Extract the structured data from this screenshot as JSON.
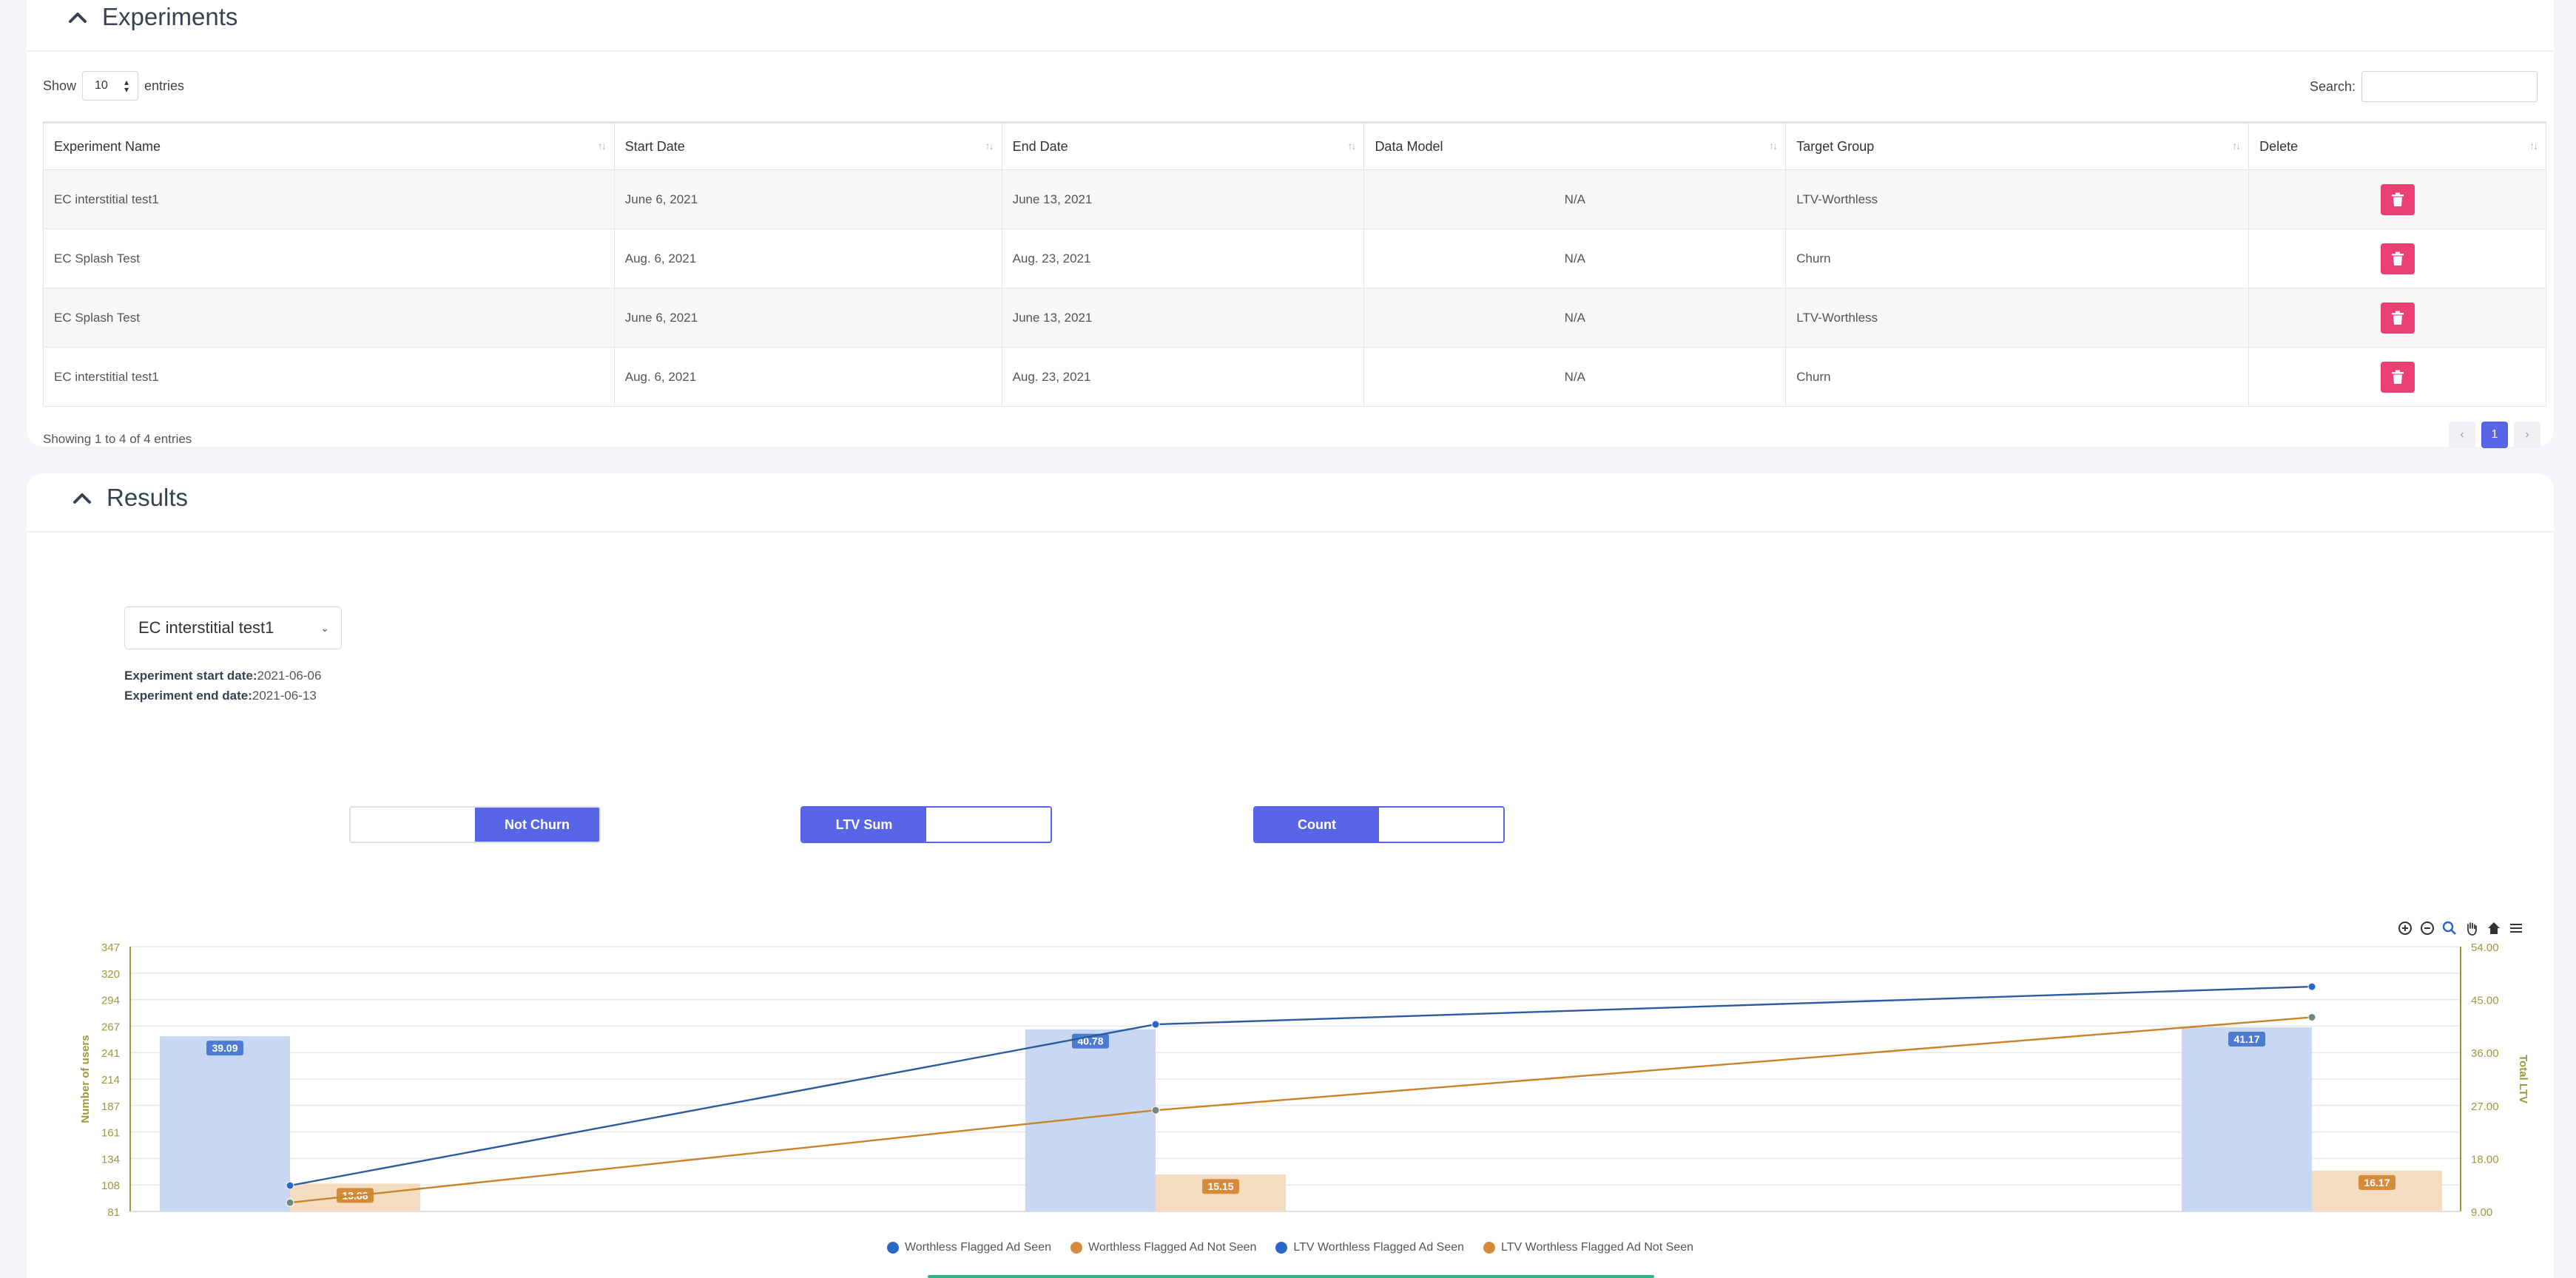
{
  "experiments": {
    "title": "Experiments",
    "show_label": "Show",
    "entries_label": "entries",
    "page_length": "10",
    "search_label": "Search:",
    "search_value": "",
    "columns": [
      "Experiment Name",
      "Start Date",
      "End Date",
      "Data Model",
      "Target Group",
      "Delete"
    ],
    "rows": [
      [
        "EC interstitial test1",
        "June 6, 2021",
        "June 13, 2021",
        "N/A",
        "LTV-Worthless"
      ],
      [
        "EC Splash Test",
        "Aug. 6, 2021",
        "Aug. 23, 2021",
        "N/A",
        "Churn"
      ],
      [
        "EC Splash Test",
        "June 6, 2021",
        "June 13, 2021",
        "N/A",
        "LTV-Worthless"
      ],
      [
        "EC interstitial test1",
        "Aug. 6, 2021",
        "Aug. 23, 2021",
        "N/A",
        "Churn"
      ]
    ],
    "info": "Showing 1 to 4 of 4 entries",
    "pager": {
      "prev": "‹",
      "current": "1",
      "next": "›"
    }
  },
  "results": {
    "title": "Results",
    "selected_experiment": "EC interstitial test1",
    "start_label": "Experiment start date:",
    "start_value": "2021-06-06",
    "end_label": "Experiment end date:",
    "end_value": "2021-06-13",
    "toggles": [
      {
        "left": "",
        "right": "Not Churn",
        "active": "right"
      },
      {
        "left": "LTV Sum",
        "right": "",
        "active": "left"
      },
      {
        "left": "Count",
        "right": "",
        "active": "left"
      }
    ]
  },
  "colors": {
    "accent": "#5865e6",
    "danger": "#ec3f74",
    "bar_blue": "#c9d8f2",
    "bar_orange": "#f4dcc1",
    "line_blue": "#2c5c9c",
    "line_orange": "#c8842a",
    "axis_olive": "#9a9a3c"
  },
  "chart_data": {
    "type": "bar",
    "ylabel": "Number of users",
    "y2label": "Total LTV",
    "y_ticks": [
      "81",
      "108",
      "134",
      "161",
      "187",
      "214",
      "241",
      "267",
      "294",
      "320",
      "347"
    ],
    "y2_ticks": [
      "9.00",
      "18.00",
      "27.00",
      "36.00",
      "45.00",
      "54.00"
    ],
    "ylim": [
      81,
      347
    ],
    "y2lim": [
      9,
      54
    ],
    "groups": 3,
    "series": [
      {
        "name": "Worthless Flagged Ad Seen",
        "kind": "bar",
        "values": [
          257,
          264,
          266
        ],
        "labels": [
          "39.09",
          "40.78",
          "41.17"
        ]
      },
      {
        "name": "Worthless Flagged Ad Not Seen",
        "kind": "bar",
        "values": [
          109,
          118,
          122
        ],
        "labels": [
          "13.88",
          "15.15",
          "16.17"
        ]
      },
      {
        "name": "LTV Worthless Flagged Ad Seen",
        "kind": "line",
        "values": [
          13.4,
          40.8,
          47.2
        ]
      },
      {
        "name": "LTV Worthless Flagged Ad Not Seen",
        "kind": "line",
        "values": [
          10.5,
          26.2,
          42.0
        ]
      }
    ],
    "legend_position": "bottom",
    "grid": true
  }
}
